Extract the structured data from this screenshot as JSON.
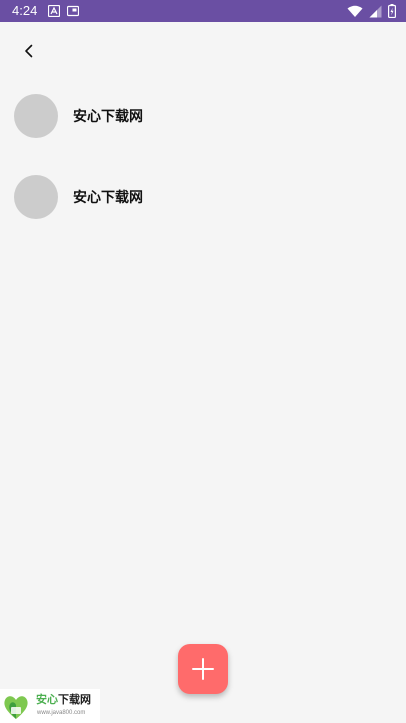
{
  "status_bar": {
    "time": "4:24",
    "background_color": "#6a4fa3",
    "left_icons": [
      "a-notification-icon",
      "media-notification-icon"
    ],
    "right_icons": [
      "wifi-icon",
      "cell-signal-icon",
      "battery-charging-icon"
    ]
  },
  "header": {
    "back_icon": "chevron-left-icon"
  },
  "list": {
    "items": [
      {
        "label": "安心下载网",
        "avatar_color": "#cccccc"
      },
      {
        "label": "安心下载网",
        "avatar_color": "#cccccc"
      }
    ]
  },
  "fab": {
    "icon": "plus-icon",
    "color": "#ff6b6b"
  },
  "watermark": {
    "title_part1": "安心",
    "title_part2": "下载网",
    "url": "www.java800.com",
    "accent_color": "#4caf50"
  },
  "colors": {
    "background": "#f5f5f5",
    "text": "#111111"
  }
}
